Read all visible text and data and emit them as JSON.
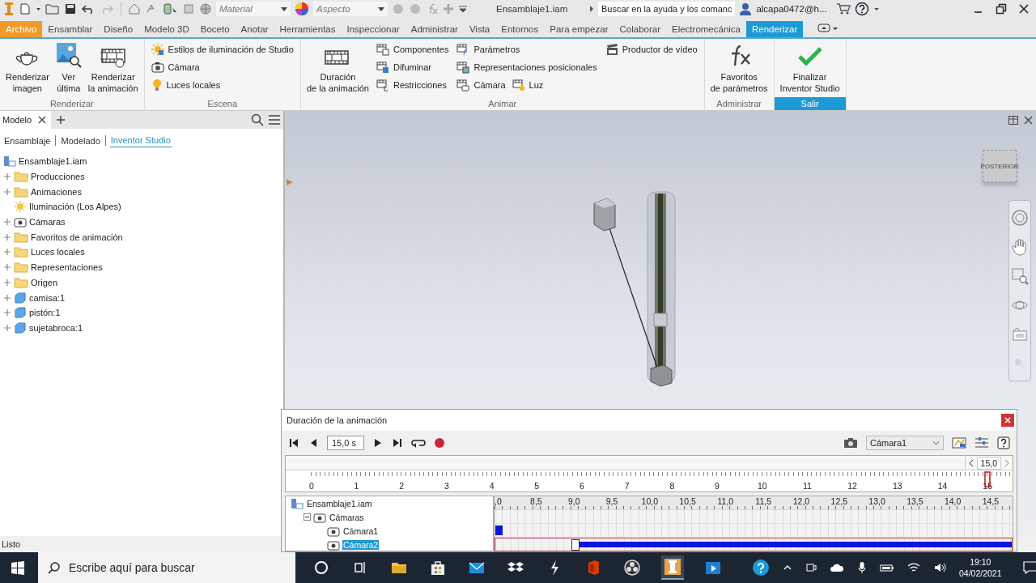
{
  "title_bar": {
    "material": "Material",
    "appearance": "Aspecto",
    "document": "Ensamblaje1.iam",
    "search": {
      "value": "Buscar en la ayuda y los comanc"
    },
    "user": "alcapa0472@h..."
  },
  "ribbon_tabs": [
    {
      "label": "Archivo",
      "kind": "application",
      "selected": false
    },
    {
      "label": "Ensamblar",
      "kind": "tab",
      "selected": false
    },
    {
      "label": "Diseño",
      "kind": "tab",
      "selected": false
    },
    {
      "label": "Modelo 3D",
      "kind": "tab",
      "selected": false
    },
    {
      "label": "Boceto",
      "kind": "tab",
      "selected": false
    },
    {
      "label": "Anotar",
      "kind": "tab",
      "selected": false
    },
    {
      "label": "Herramientas",
      "kind": "tab",
      "selected": false
    },
    {
      "label": "Inspeccionar",
      "kind": "tab",
      "selected": false
    },
    {
      "label": "Administrar",
      "kind": "tab",
      "selected": false
    },
    {
      "label": "Vista",
      "kind": "tab",
      "selected": false
    },
    {
      "label": "Entornos",
      "kind": "tab",
      "selected": false
    },
    {
      "label": "Para empezar",
      "kind": "tab",
      "selected": false
    },
    {
      "label": "Colaborar",
      "kind": "tab",
      "selected": false
    },
    {
      "label": "Electromecánica",
      "kind": "tab",
      "selected": false
    },
    {
      "label": "Renderizar",
      "kind": "tab",
      "selected": true
    }
  ],
  "ribbon_groups": [
    {
      "label": "Renderizar",
      "highlighted": false,
      "items": [
        {
          "kind": "large",
          "label": "Renderizar\nimagen"
        },
        {
          "kind": "large",
          "label": "Ver\núltima"
        },
        {
          "kind": "large",
          "label": "Renderizar\nla animación"
        }
      ]
    },
    {
      "label": "Escena",
      "highlighted": false,
      "items": [
        {
          "kind": "stack",
          "rows": [
            [
              {
                "label": "Estilos de iluminación de Studio"
              }
            ],
            [
              {
                "label": "Cámara"
              }
            ],
            [
              {
                "label": "Luces locales"
              }
            ]
          ]
        }
      ]
    },
    {
      "label": "Animar",
      "highlighted": false,
      "items": [
        {
          "kind": "large",
          "label": "Duración\nde la animación"
        },
        {
          "kind": "stack",
          "rows": [
            [
              {
                "label": "Componentes"
              }
            ],
            [
              {
                "label": "Difuminar"
              }
            ],
            [
              {
                "label": "Restricciones"
              }
            ]
          ]
        },
        {
          "kind": "stack",
          "rows": [
            [
              {
                "label": "Parámetros"
              }
            ],
            [
              {
                "label": "Representaciones posicionales"
              }
            ],
            [
              {
                "label": "Cámara"
              },
              {
                "label": "Luz"
              }
            ]
          ]
        },
        {
          "kind": "stack",
          "rows": [
            [
              {
                "label": "Productor de vídeo"
              }
            ]
          ]
        }
      ]
    },
    {
      "label": "Administrar",
      "highlighted": false,
      "items": [
        {
          "kind": "large",
          "label": "Favoritos\nde parámetros"
        }
      ]
    },
    {
      "label": "Salir",
      "highlighted": true,
      "items": [
        {
          "kind": "large",
          "label": "Finalizar\nInventor Studio"
        }
      ]
    }
  ],
  "browser": {
    "tab": "Modelo",
    "filters": [
      {
        "label": "Ensamblaje",
        "selected": false
      },
      {
        "label": "Modelado",
        "selected": false
      },
      {
        "label": "Inventor Studio",
        "selected": true
      }
    ],
    "tree": [
      {
        "label": "Ensamblaje1.iam",
        "kind": "assembly",
        "children": [
          {
            "label": "Producciones",
            "kind": "folder",
            "expanded": false
          },
          {
            "label": "Animaciones",
            "kind": "folder",
            "expanded": false
          },
          {
            "label": "Iluminación (Los Alpes)",
            "kind": "light"
          },
          {
            "label": "Cámaras",
            "kind": "camera",
            "expanded": false
          },
          {
            "label": "Favoritos de animación",
            "kind": "folder",
            "expanded": false
          },
          {
            "label": "Luces locales",
            "kind": "folder",
            "expanded": false
          },
          {
            "label": "Representaciones",
            "kind": "folder",
            "expanded": false
          },
          {
            "label": "Origen",
            "kind": "folder",
            "expanded": false
          },
          {
            "label": "camisa:1",
            "kind": "part",
            "expanded": false
          },
          {
            "label": "pistón:1",
            "kind": "part",
            "expanded": false
          },
          {
            "label": "sujetabroca:1",
            "kind": "part",
            "expanded": false
          }
        ]
      }
    ]
  },
  "viewport": {
    "view_cube": "POSTERIOR"
  },
  "dialog": {
    "title": "Duración de la animación",
    "time": "15,0 s",
    "camera": "Cámara1",
    "end_time": "15,0",
    "ruler": [
      "0",
      "1",
      "2",
      "3",
      "4",
      "5",
      "6",
      "7",
      "8",
      "9",
      "10",
      "11",
      "12",
      "13",
      "14",
      "15"
    ],
    "track_scale": [
      ",0",
      "8,5",
      "9,0",
      "9,5",
      "10,0",
      "10,5",
      "11,0",
      "11,5",
      "12,0",
      "12,5",
      "13,0",
      "13,5",
      "14,0",
      "14,5"
    ],
    "tracks": [
      {
        "label": "Ensamblaje1.iam",
        "kind": "assembly",
        "selected": false,
        "children": [
          {
            "label": "Cámaras",
            "kind": "camera",
            "expanded": true,
            "selected": false,
            "children": [
              {
                "label": "Cámara1",
                "kind": "camera",
                "selected": false,
                "bar": {
                  "kind": "keyframe"
                }
              },
              {
                "label": "Cámara2",
                "kind": "camera",
                "selected": true,
                "bar": {
                  "kind": "span"
                }
              }
            ]
          }
        ]
      }
    ]
  },
  "status_bar": "Listo",
  "taskbar": {
    "search": {
      "placeholder": "Escribe aquí para buscar"
    },
    "time": "19:10",
    "date": "04/02/2021"
  }
}
